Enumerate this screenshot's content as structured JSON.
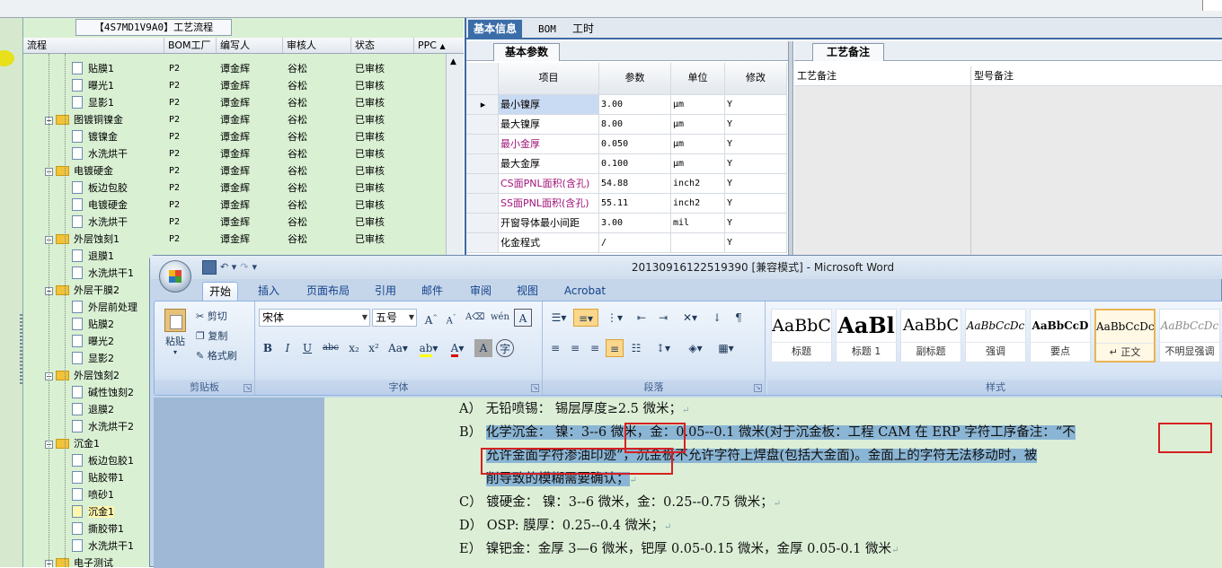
{
  "tree": {
    "title": "【4S7MD1V9A0】工艺流程",
    "headers": [
      "流程",
      "BOM工厂",
      "编写人",
      "审核人",
      "状态",
      "PPC"
    ],
    "rows": [
      {
        "level": 2,
        "type": "file",
        "name": "贴膜1",
        "bom": "P2",
        "writer": "谭金辉",
        "reviewer": "谷松",
        "status": "已审核"
      },
      {
        "level": 2,
        "type": "file",
        "name": "曝光1",
        "bom": "P2",
        "writer": "谭金辉",
        "reviewer": "谷松",
        "status": "已审核"
      },
      {
        "level": 2,
        "type": "file",
        "name": "显影1",
        "bom": "P2",
        "writer": "谭金辉",
        "reviewer": "谷松",
        "status": "已审核"
      },
      {
        "level": 1,
        "type": "folder",
        "name": "图镀铜镍金",
        "bom": "P2",
        "writer": "谭金辉",
        "reviewer": "谷松",
        "status": "已审核"
      },
      {
        "level": 2,
        "type": "file",
        "name": "镀镍金",
        "bom": "P2",
        "writer": "谭金辉",
        "reviewer": "谷松",
        "status": "已审核"
      },
      {
        "level": 2,
        "type": "file",
        "name": "水洗烘干",
        "bom": "P2",
        "writer": "谭金辉",
        "reviewer": "谷松",
        "status": "已审核"
      },
      {
        "level": 1,
        "type": "folder",
        "name": "电镀硬金",
        "bom": "P2",
        "writer": "谭金辉",
        "reviewer": "谷松",
        "status": "已审核"
      },
      {
        "level": 2,
        "type": "file",
        "name": "板边包胶",
        "bom": "P2",
        "writer": "谭金辉",
        "reviewer": "谷松",
        "status": "已审核"
      },
      {
        "level": 2,
        "type": "file",
        "name": "电镀硬金",
        "bom": "P2",
        "writer": "谭金辉",
        "reviewer": "谷松",
        "status": "已审核"
      },
      {
        "level": 2,
        "type": "file",
        "name": "水洗烘干",
        "bom": "P2",
        "writer": "谭金辉",
        "reviewer": "谷松",
        "status": "已审核"
      },
      {
        "level": 1,
        "type": "folder",
        "name": "外层蚀刻1",
        "bom": "P2",
        "writer": "谭金辉",
        "reviewer": "谷松",
        "status": "已审核"
      },
      {
        "level": 2,
        "type": "file",
        "name": "退膜1",
        "bom": "",
        "writer": "",
        "reviewer": "",
        "status": ""
      },
      {
        "level": 2,
        "type": "file",
        "name": "水洗烘干1",
        "bom": "",
        "writer": "",
        "reviewer": "",
        "status": ""
      },
      {
        "level": 1,
        "type": "folder",
        "name": "外层干膜2",
        "bom": "",
        "writer": "",
        "reviewer": "",
        "status": ""
      },
      {
        "level": 2,
        "type": "file",
        "name": "外层前处理",
        "bom": "",
        "writer": "",
        "reviewer": "",
        "status": ""
      },
      {
        "level": 2,
        "type": "file",
        "name": "贴膜2",
        "bom": "",
        "writer": "",
        "reviewer": "",
        "status": ""
      },
      {
        "level": 2,
        "type": "file",
        "name": "曝光2",
        "bom": "",
        "writer": "",
        "reviewer": "",
        "status": ""
      },
      {
        "level": 2,
        "type": "file",
        "name": "显影2",
        "bom": "",
        "writer": "",
        "reviewer": "",
        "status": ""
      },
      {
        "level": 1,
        "type": "folder",
        "name": "外层蚀刻2",
        "bom": "",
        "writer": "",
        "reviewer": "",
        "status": ""
      },
      {
        "level": 2,
        "type": "file",
        "name": "碱性蚀刻2",
        "bom": "",
        "writer": "",
        "reviewer": "",
        "status": ""
      },
      {
        "level": 2,
        "type": "file",
        "name": "退膜2",
        "bom": "",
        "writer": "",
        "reviewer": "",
        "status": ""
      },
      {
        "level": 2,
        "type": "file",
        "name": "水洗烘干2",
        "bom": "",
        "writer": "",
        "reviewer": "",
        "status": ""
      },
      {
        "level": 1,
        "type": "folder",
        "name": "沉金1",
        "bom": "",
        "writer": "",
        "reviewer": "",
        "status": ""
      },
      {
        "level": 2,
        "type": "file",
        "name": "板边包胶1",
        "bom": "",
        "writer": "",
        "reviewer": "",
        "status": ""
      },
      {
        "level": 2,
        "type": "file",
        "name": "贴胶带1",
        "bom": "",
        "writer": "",
        "reviewer": "",
        "status": ""
      },
      {
        "level": 2,
        "type": "file",
        "name": "喷砂1",
        "bom": "",
        "writer": "",
        "reviewer": "",
        "status": ""
      },
      {
        "level": 2,
        "type": "file",
        "name": "沉金1",
        "bom": "",
        "writer": "",
        "reviewer": "",
        "status": "",
        "selected": true
      },
      {
        "level": 2,
        "type": "file",
        "name": "撕胶带1",
        "bom": "",
        "writer": "",
        "reviewer": "",
        "status": ""
      },
      {
        "level": 2,
        "type": "file",
        "name": "水洗烘干1",
        "bom": "",
        "writer": "",
        "reviewer": "",
        "status": ""
      },
      {
        "level": 1,
        "type": "folder",
        "name": "电子测试",
        "bom": "",
        "writer": "",
        "reviewer": "",
        "status": ""
      }
    ]
  },
  "right": {
    "tabs": [
      "基本信息",
      "BOM",
      "工时"
    ],
    "basic_title": "基本参数",
    "grid_headers": [
      "项目",
      "参数",
      "单位",
      "修改"
    ],
    "grid_rows": [
      {
        "item": "最小镍厚",
        "value": "3.00",
        "unit": "μm",
        "mod": "Y",
        "pink": false,
        "current": true
      },
      {
        "item": "最大镍厚",
        "value": "8.00",
        "unit": "μm",
        "mod": "Y",
        "pink": false
      },
      {
        "item": "最小金厚",
        "value": "0.050",
        "unit": "μm",
        "mod": "Y",
        "pink": true
      },
      {
        "item": "最大金厚",
        "value": "0.100",
        "unit": "μm",
        "mod": "Y",
        "pink": false
      },
      {
        "item": "CS面PNL面积(含孔)",
        "value": "54.88",
        "unit": "inch2",
        "mod": "Y",
        "pink": true
      },
      {
        "item": "SS面PNL面积(含孔)",
        "value": "55.11",
        "unit": "inch2",
        "mod": "Y",
        "pink": true
      },
      {
        "item": "开窗导体最小间距",
        "value": "3.00",
        "unit": "mil",
        "mod": "Y",
        "pink": false
      },
      {
        "item": "化金程式",
        "value": "/",
        "unit": "",
        "mod": "Y",
        "pink": false
      }
    ],
    "notes_title": "工艺备注",
    "notes_cols": [
      "工艺备注",
      "型号备注"
    ]
  },
  "word": {
    "caption": "20130916122519390 [兼容模式] - Microsoft Word",
    "tabs": [
      "开始",
      "插入",
      "页面布局",
      "引用",
      "邮件",
      "审阅",
      "视图",
      "Acrobat"
    ],
    "clipboard": {
      "paste": "粘贴",
      "cut": "剪切",
      "copy": "复制",
      "format_painter": "格式刷",
      "label": "剪贴板"
    },
    "font": {
      "name": "宋体",
      "size": "五号",
      "label": "字体"
    },
    "paragraph_label": "段落",
    "styles_label": "样式",
    "styles": [
      {
        "sample": "AaBbC",
        "label": "标题"
      },
      {
        "sample": "AaBl",
        "label": "标题 1"
      },
      {
        "sample": "AaBbC",
        "label": "副标题"
      },
      {
        "sample": "AaBbCcDc",
        "label": "强调"
      },
      {
        "sample": "AaBbCcD",
        "label": "要点"
      },
      {
        "sample": "AaBbCcDc",
        "label": "↵ 正文"
      },
      {
        "sample": "AaBbCcDc",
        "label": "不明显强调"
      }
    ],
    "doc": {
      "line_a": "A） 无铅喷锡：  锡层厚度≥2.5 微米；",
      "line_b1_label": "B）",
      "line_b1_text": "化学沉金：  镍：3--6 微米，金：0.05--0.1 微米(对于沉金板：工程 CAM 在 ERP 字符工序备注：“不",
      "line_b2_part1": "允许金面字符渗油印迹”，",
      "line_b2_part2": "沉金板不允许字符上焊盘(包括大金面)。金面上的字符无法移动时，被",
      "line_b3": "削导致的模糊需要确认；",
      "line_c": "C） 镀硬金：      镍：3--6 微米，金：0.25--0.75 微米；",
      "line_d": "D） OSP:          膜厚：0.25--0.4 微米；",
      "line_e": "E） 镍钯金：金厚 3—6 微米，钯厚 0.05-0.15 微米，金厚 0.05-0.1 微米",
      "para_mark": "↵"
    }
  }
}
